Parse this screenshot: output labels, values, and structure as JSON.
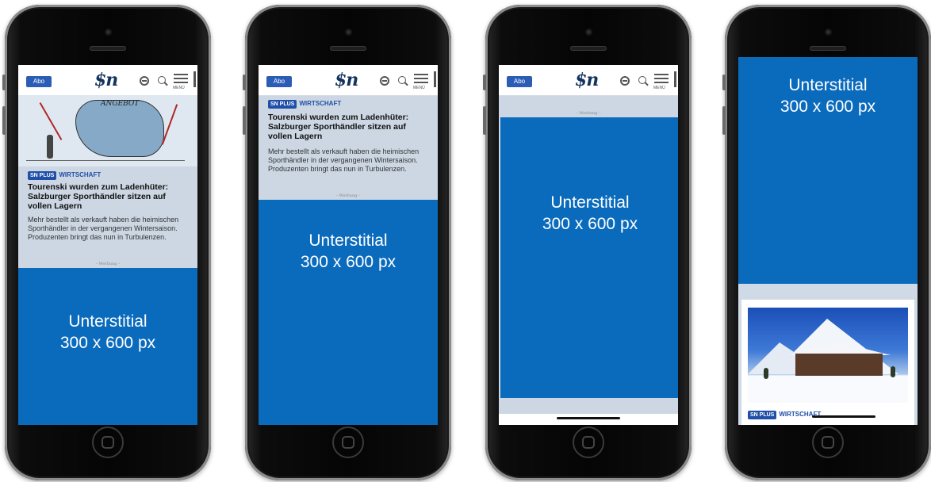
{
  "header": {
    "abo_label": "Abo",
    "logo_text": "$n",
    "menu_label": "MENÜ"
  },
  "article": {
    "cartoon_caption": "ANGEBOT",
    "plus_badge": "SN PLUS",
    "section": "WIRTSCHAFT",
    "headline": "Tourenski wurden zum Ladenhüter: Salzburger Sporthändler sitzen auf vollen Lagern",
    "lead": "Mehr bestellt als verkauft haben die heimischen Sporthändler in der vergangenen Wintersaison. Produzenten bringt das nun in Turbulenzen."
  },
  "ad_marker": "– Werbung –",
  "interstitial": {
    "line1": "Unterstitial",
    "line2": "300 x 600 px"
  },
  "colors": {
    "ad_blue": "#0a6bbd",
    "brand_blue": "#1f4fa8",
    "screen_bg": "#ccd7e3"
  }
}
